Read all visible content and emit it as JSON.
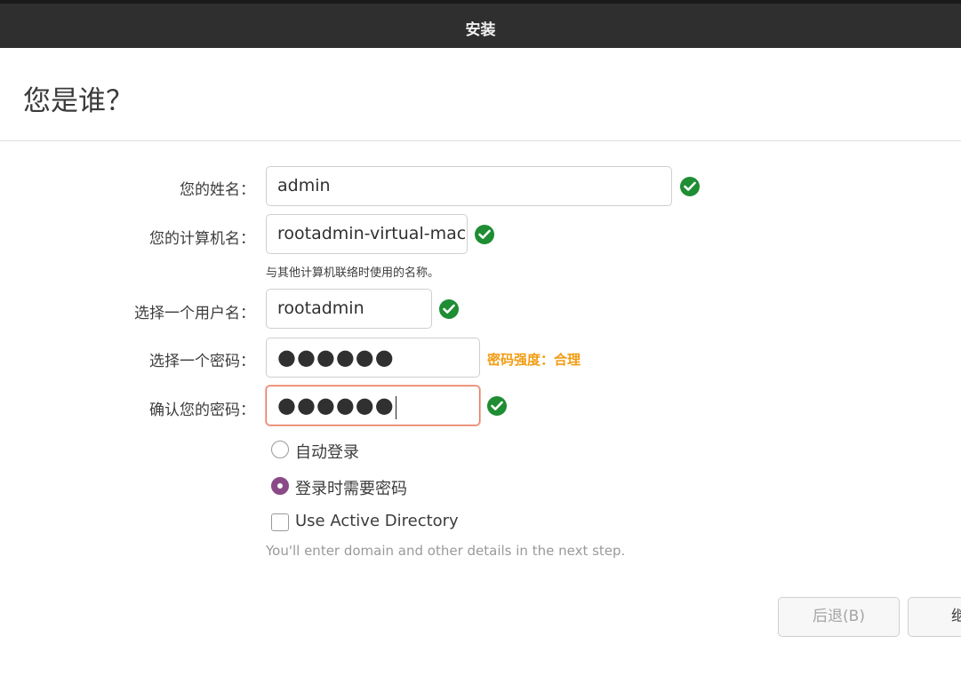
{
  "window": {
    "title": "安装"
  },
  "page": {
    "heading": "您是谁？"
  },
  "form": {
    "name": {
      "label": "您的姓名：",
      "value": "admin",
      "valid": true
    },
    "computer": {
      "label": "您的计算机名：",
      "value": "rootadmin-virtual-mac",
      "hint": "与其他计算机联络时使用的名称。",
      "valid": true
    },
    "username": {
      "label": "选择一个用户名：",
      "value": "rootadmin",
      "valid": true
    },
    "password": {
      "label": "选择一个密码：",
      "value": "●●●●●●",
      "strength": "密码强度：合理"
    },
    "confirm": {
      "label": "确认您的密码：",
      "value": "●●●●●●",
      "valid": true
    }
  },
  "login_options": {
    "auto_login": {
      "label": "自动登录",
      "selected": false
    },
    "require_password": {
      "label": "登录时需要密码",
      "selected": true
    }
  },
  "active_directory": {
    "label": "Use Active Directory",
    "checked": false,
    "note": "You'll enter domain and other details in the next step."
  },
  "buttons": {
    "back": "后退(B)",
    "continue": "继"
  },
  "colors": {
    "valid_check": "#1e8d33",
    "strength_text": "#f39c12",
    "radio_selected": "#8a4a87",
    "focus_border": "#e9765a"
  }
}
